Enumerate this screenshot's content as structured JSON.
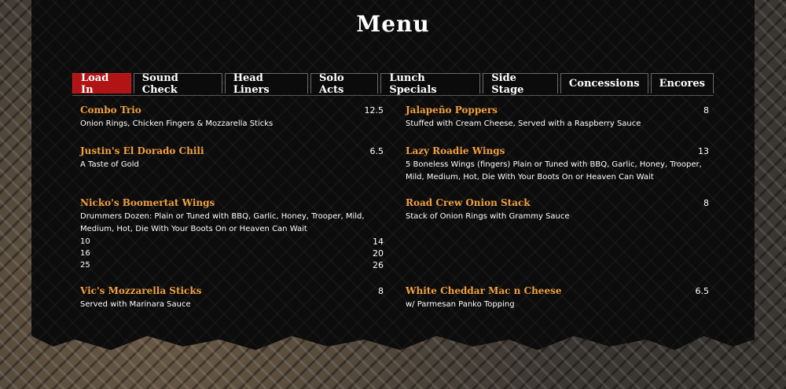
{
  "title": "Menu",
  "tabs": [
    {
      "label": "Load In",
      "active": true
    },
    {
      "label": "Sound Check"
    },
    {
      "label": "Head Liners"
    },
    {
      "label": "Solo Acts"
    },
    {
      "label": "Lunch Specials"
    },
    {
      "label": "Side Stage"
    },
    {
      "label": "Concessions"
    },
    {
      "label": "Encores"
    }
  ],
  "left_items": [
    {
      "name": "Combo Trio",
      "price": "12.5",
      "desc": "Onion Rings, Chicken Fingers & Mozzarella Sticks"
    },
    {
      "name": "Justin's El Dorado Chili",
      "price": "6.5",
      "desc": "A Taste of Gold"
    },
    {
      "name": "Nicko's Boomertat Wings",
      "price": "",
      "desc": "Drummers Dozen: Plain or Tuned with BBQ, Garlic, Honey, Trooper, Mild, Medium, Hot, Die With Your Boots On or Heaven Can Wait",
      "sizes": [
        {
          "qty": "10",
          "price": "14"
        },
        {
          "qty": "16",
          "price": "20"
        },
        {
          "qty": "25",
          "price": "26"
        }
      ]
    },
    {
      "name": "Vic's Mozzarella Sticks",
      "price": "8",
      "desc": "Served with Marinara Sauce"
    }
  ],
  "right_items": [
    {
      "name": "Jalapeño Poppers",
      "price": "8",
      "desc": "Stuffed with Cream Cheese, Served with a Raspberry Sauce"
    },
    {
      "name": "Lazy Roadie Wings",
      "price": "13",
      "desc": "5 Boneless Wings (fingers) Plain or Tuned with BBQ, Garlic, Honey, Trooper, Mild, Medium, Hot, Die With Your Boots On or Heaven Can Wait"
    },
    {
      "name": "Road Crew Onion Stack",
      "price": "8",
      "desc": "Stack of Onion Rings with Grammy Sauce"
    },
    {
      "name": "White Cheddar Mac n Cheese",
      "price": "6.5",
      "desc": "w/ Parmesan Panko Topping"
    }
  ]
}
